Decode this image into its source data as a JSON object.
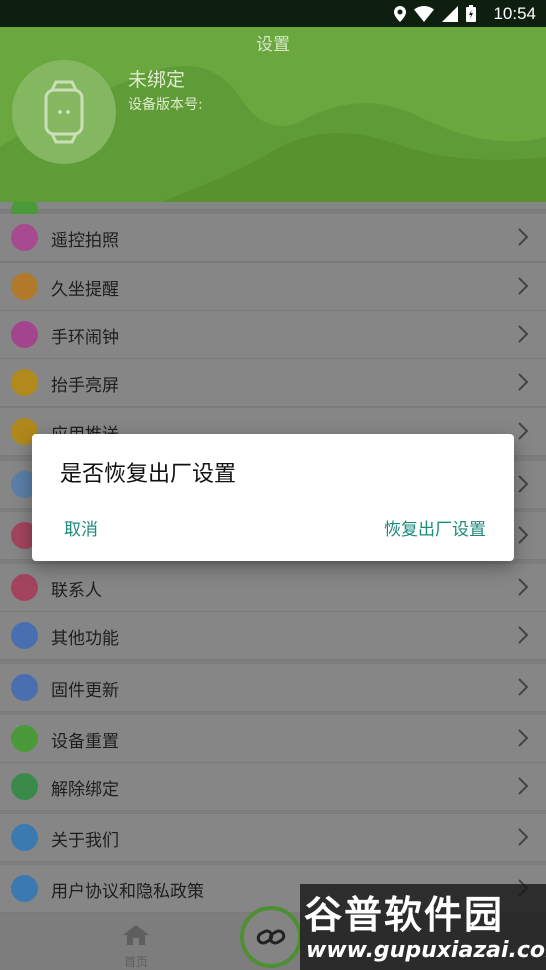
{
  "status_bar": {
    "time": "10:54"
  },
  "header": {
    "title": "设置",
    "device_name": "未绑定",
    "device_version_label": "设备版本号:"
  },
  "settings_items": [
    {
      "label": "遥控拍照",
      "color": "#a74a8f"
    },
    {
      "label": "久坐提醒",
      "color": "#b07a2a"
    },
    {
      "label": "手环闹钟",
      "color": "#a3448f"
    },
    {
      "label": "抬手亮屏",
      "color": "#b08a1a"
    },
    {
      "label": "应用推送",
      "color": "#b0881c"
    },
    {
      "label": "",
      "color": "#5b7fa8"
    },
    {
      "label": "",
      "color": "#a3445f"
    },
    {
      "label": "联系人",
      "color": "#a3445f"
    },
    {
      "label": "其他功能",
      "color": "#4a6fb0"
    },
    {
      "label": "固件更新",
      "color": "#4a6fb0"
    },
    {
      "label": "设备重置",
      "color": "#4a9a3a"
    },
    {
      "label": "解除绑定",
      "color": "#3a8a4a"
    },
    {
      "label": "关于我们",
      "color": "#3a7ab0"
    },
    {
      "label": "用户协议和隐私政策",
      "color": "#3a7ab0"
    }
  ],
  "dialog": {
    "title": "是否恢复出厂设置",
    "cancel": "取消",
    "confirm": "恢复出厂设置"
  },
  "bottom_nav": {
    "home_label": "首页"
  },
  "watermark": {
    "cn": "谷普软件园",
    "url": "www.gupuxiazai.com"
  }
}
